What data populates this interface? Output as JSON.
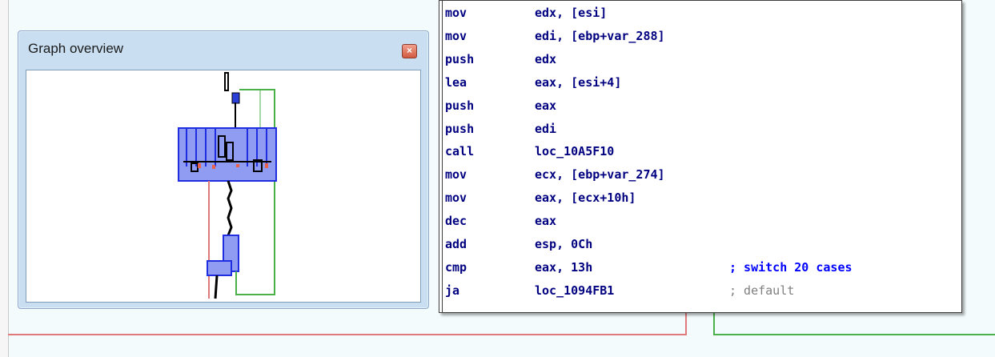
{
  "graph_overview": {
    "title": "Graph overview",
    "close_glyph": "×"
  },
  "disassembly": [
    {
      "mnemonic": "mov",
      "operand": "edx, [esi]",
      "comment": ""
    },
    {
      "mnemonic": "mov",
      "operand": "edi, [ebp+var_288]",
      "comment": ""
    },
    {
      "mnemonic": "push",
      "operand": "edx",
      "comment": ""
    },
    {
      "mnemonic": "lea",
      "operand": "eax, [esi+4]",
      "comment": ""
    },
    {
      "mnemonic": "push",
      "operand": "eax",
      "comment": ""
    },
    {
      "mnemonic": "push",
      "operand": "edi",
      "comment": ""
    },
    {
      "mnemonic": "call",
      "operand": "loc_10A5F10",
      "comment": ""
    },
    {
      "mnemonic": "mov",
      "operand": "ecx, [ebp+var_274]",
      "comment": ""
    },
    {
      "mnemonic": "mov",
      "operand": "eax, [ecx+10h]",
      "comment": ""
    },
    {
      "mnemonic": "dec",
      "operand": "eax",
      "comment": ""
    },
    {
      "mnemonic": "add",
      "operand": "esp, 0Ch",
      "comment": ""
    },
    {
      "mnemonic": "cmp",
      "operand": "eax, 13h",
      "comment": "; switch 20 cases"
    },
    {
      "mnemonic": "ja",
      "operand": "loc_1094FB1",
      "comment": "; default"
    }
  ],
  "colors": {
    "mnemonic": "#000080",
    "comment": "#0000ff",
    "comment_default": "#7f7f7f",
    "edge_true": "#4ab04a",
    "edge_false": "#e07a7a"
  }
}
